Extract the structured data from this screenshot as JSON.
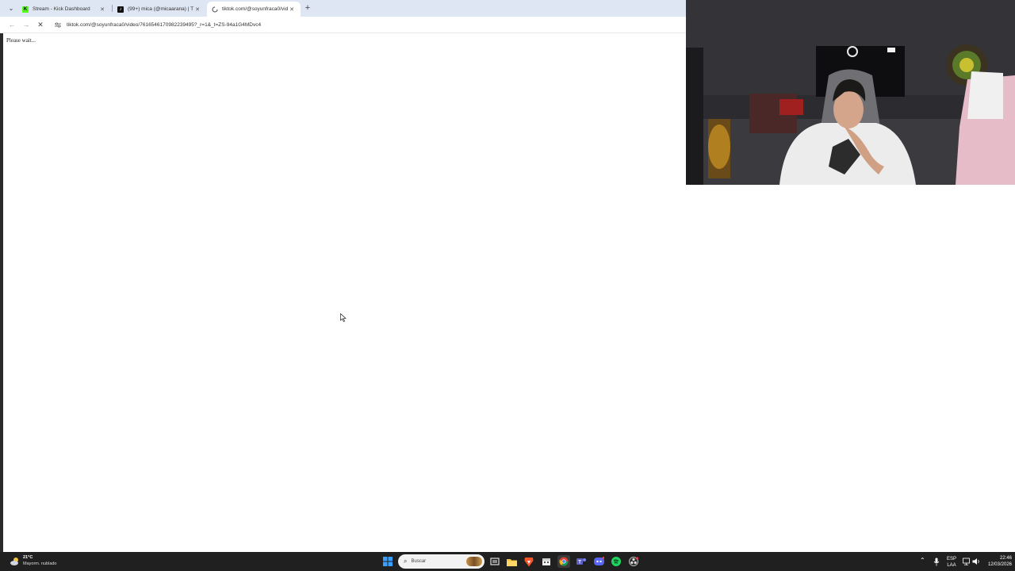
{
  "browser": {
    "tabs": [
      {
        "title": "Stream - Kick Dashboard",
        "favicon": "kick-icon",
        "color": "#53fc18",
        "active": false
      },
      {
        "title": "(99+) mica (@micaarana) | TikTok",
        "favicon": "tiktok-icon",
        "color": "#111111",
        "active": false
      },
      {
        "title": "tiktok.com/@soyunfraca0/video/7616546170982...",
        "favicon": "loading-spinner-icon",
        "color": "#5f6368",
        "active": true
      }
    ],
    "address_bar": {
      "url": "tiktok.com/@soyunfraca0/video/7616546170982239495?_r=1&_t=ZS-94a1G4MDvc4"
    }
  },
  "page": {
    "status_text": "Please wait..."
  },
  "taskbar": {
    "weather": {
      "temperature": "21°C",
      "condition": "Mayorm. nublado"
    },
    "search_placeholder": "Buscar",
    "language": {
      "code": "ESP",
      "layout": "LAA"
    },
    "clock": {
      "time": "22:46",
      "date": "12/03/2026"
    },
    "accent": "#202020"
  }
}
